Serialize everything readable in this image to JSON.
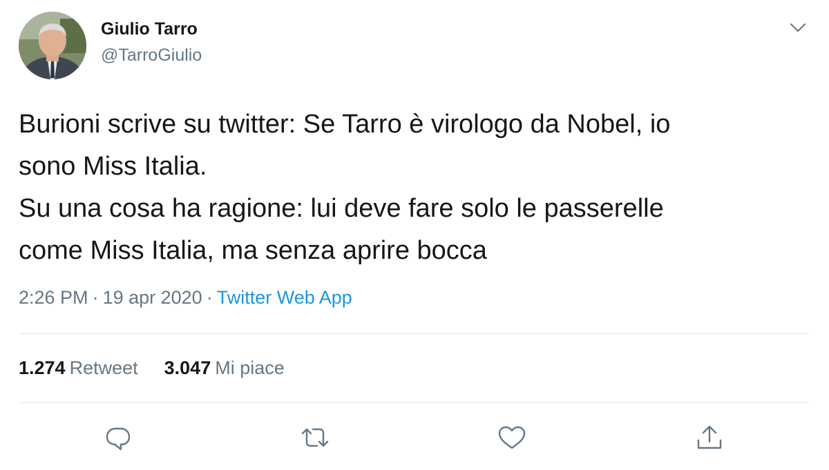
{
  "author": {
    "display_name": "Giulio Tarro",
    "handle": "@TarroGiulio"
  },
  "tweet": {
    "lines": [
      "Burioni scrive su twitter: Se Tarro è virologo da Nobel, io",
      "sono Miss Italia.",
      "Su una cosa ha ragione: lui deve fare solo le passerelle",
      "come Miss Italia, ma senza aprire bocca"
    ]
  },
  "meta": {
    "time": "2:26 PM",
    "separator": "·",
    "date": "19 apr 2020",
    "source": "Twitter Web App"
  },
  "stats": {
    "retweets_count": "1.274",
    "retweets_label": "Retweet",
    "likes_count": "3.047",
    "likes_label": "Mi piace"
  },
  "icons": {
    "more": "chevron-down-icon",
    "reply": "reply-icon",
    "retweet": "retweet-icon",
    "like": "heart-icon",
    "share": "share-icon"
  },
  "colors": {
    "text": "#14171a",
    "secondary": "#657786",
    "link": "#1b95e0",
    "divider": "#e1e8ed"
  }
}
